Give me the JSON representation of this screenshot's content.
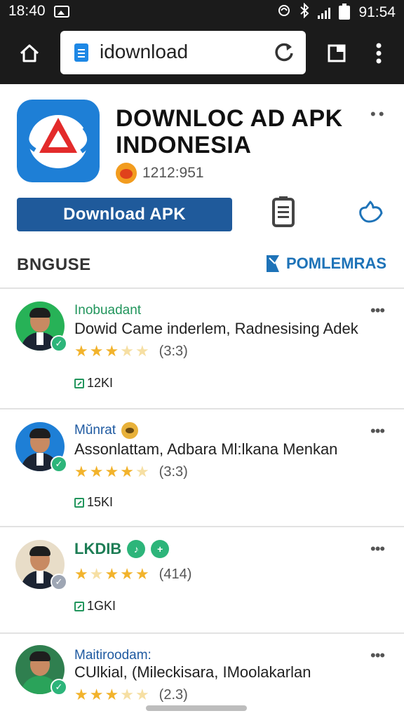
{
  "status_bar": {
    "time_left": "18:40",
    "time_right": "91:54"
  },
  "browser": {
    "url": "idownload"
  },
  "app": {
    "title": "DOWNLOC AD APK INDONESIA",
    "rating_text": "1212:951",
    "download_label": "Download APK",
    "brand_color": "#1f5a9b"
  },
  "section": {
    "left_label": "BNGUSE",
    "right_label": "POMLEMRAS"
  },
  "reviews": [
    {
      "name": "Inobuadant",
      "text": "Dowid Came inderlem, Radnesising Adek",
      "stars": 3.5,
      "count": "(3:3)",
      "meta": "12KI",
      "name_color": "#21955c"
    },
    {
      "name": "Mŭnrat",
      "text": "Assonlattam, Adbara Ml:lkana Menkan",
      "stars": 4,
      "count": "(3:3)",
      "meta": "15KI",
      "name_color": "#1f5aa1"
    },
    {
      "name": "LKDIB",
      "text": "",
      "stars": 4,
      "count": "(414)",
      "meta": "1GKI",
      "name_color": "#1d7d55"
    },
    {
      "name": "Maitiroodam:",
      "text": "CUlkial, (Mileckisara, IMoolakarlan",
      "stars": 3.5,
      "count": "(2.3)",
      "meta": "",
      "name_color": "#1f5aa1"
    }
  ]
}
